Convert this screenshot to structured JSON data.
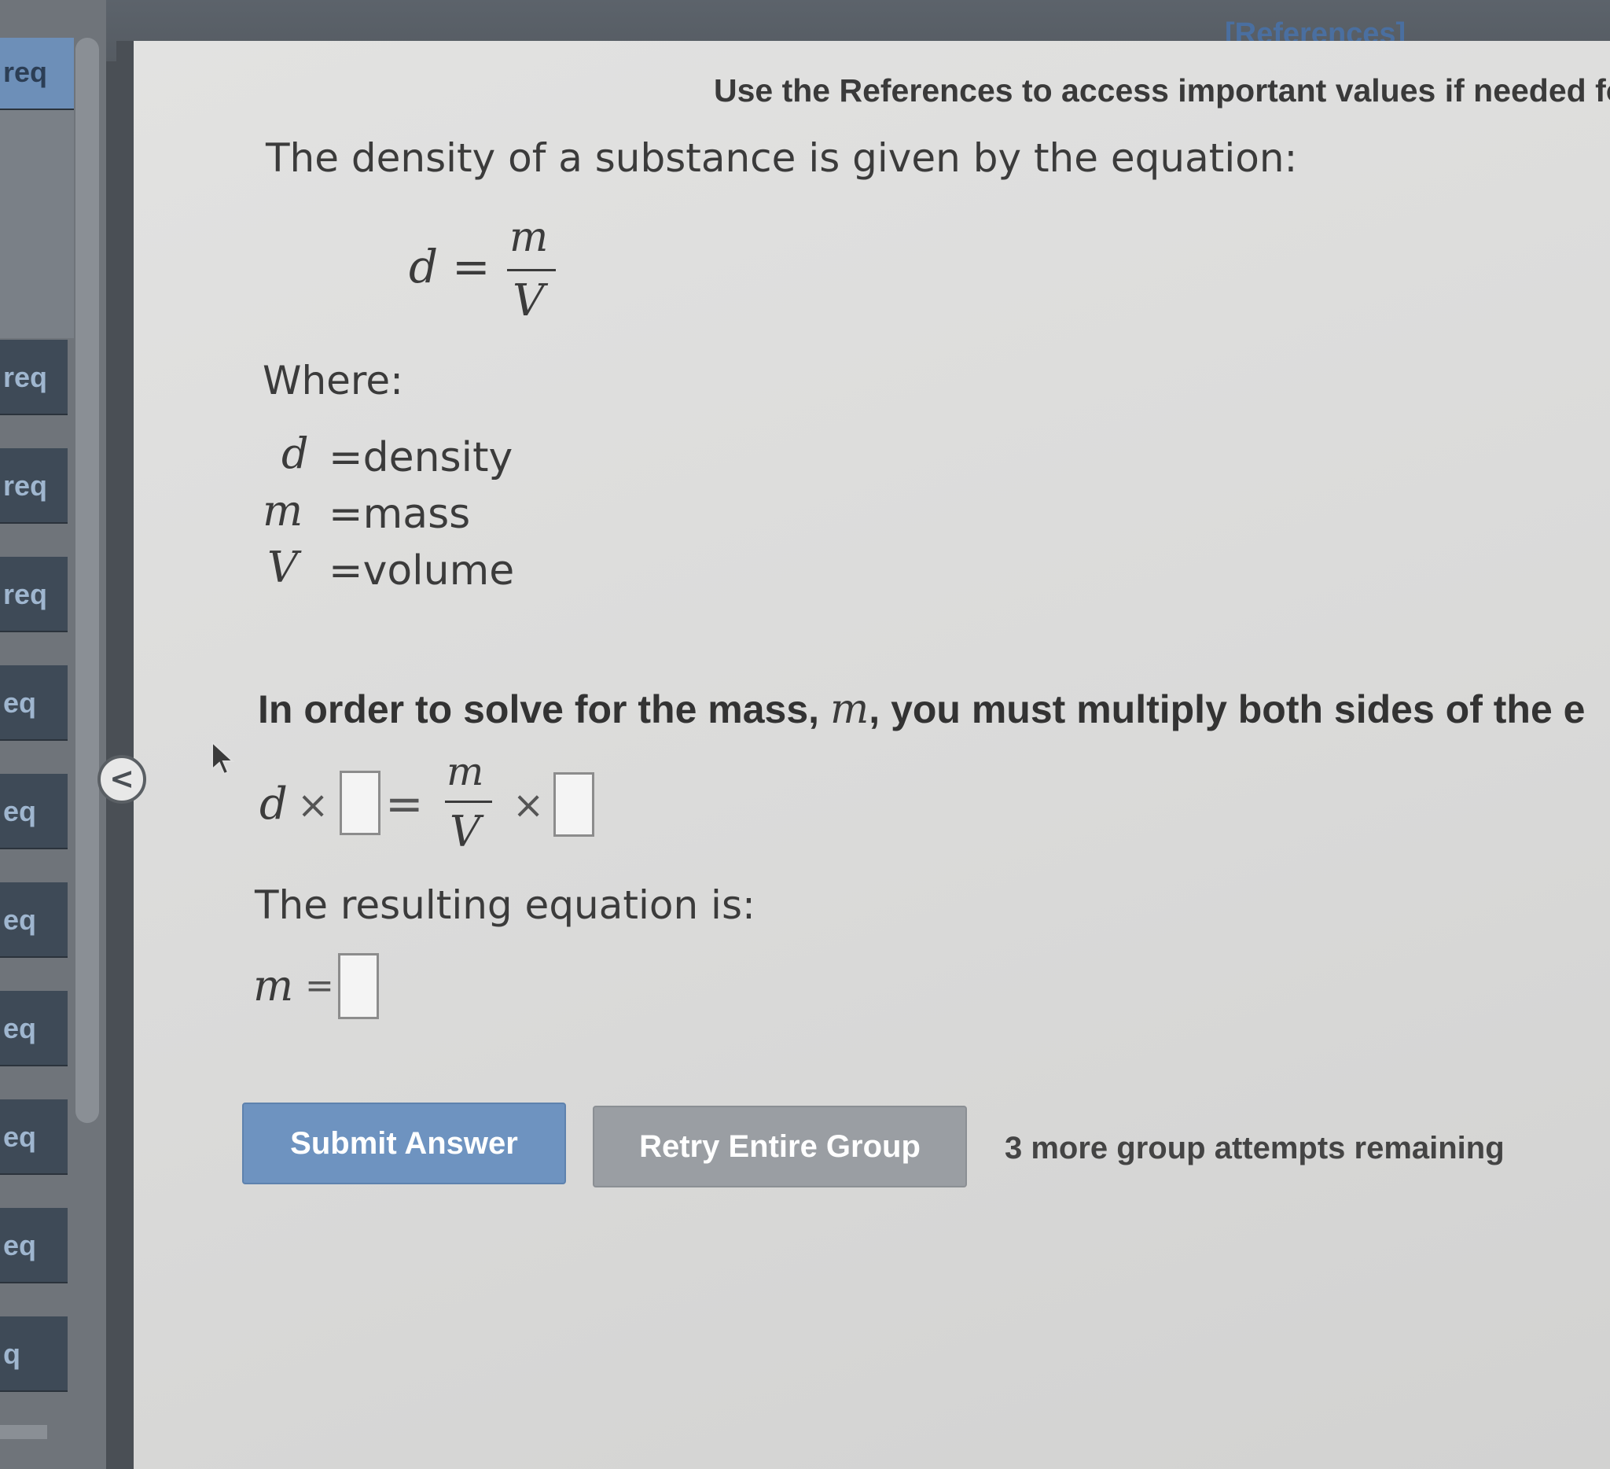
{
  "header": {
    "references_link": "[References]",
    "reference_note": "Use the References to access important values if needed fo"
  },
  "sidebar": {
    "items": [
      {
        "label": "req"
      },
      {
        "label": "req"
      },
      {
        "label": "req"
      },
      {
        "label": "req"
      },
      {
        "label": "eq"
      },
      {
        "label": "eq"
      },
      {
        "label": "eq"
      },
      {
        "label": "eq"
      },
      {
        "label": "eq"
      },
      {
        "label": "eq"
      },
      {
        "label": "q"
      }
    ],
    "collapse_glyph": "<"
  },
  "question": {
    "intro": "The density of a substance is given by the equation:",
    "equation": {
      "lhs": "d",
      "equals": "=",
      "numerator": "m",
      "denominator": "V"
    },
    "where_label": "Where:",
    "definitions": [
      {
        "symbol": "d",
        "meaning": "=density"
      },
      {
        "symbol": "m",
        "meaning": "=mass"
      },
      {
        "symbol": "V",
        "meaning": "=volume"
      }
    ],
    "instruction_prefix": "In order to solve for the mass, ",
    "instruction_symbol": "m",
    "instruction_suffix": ", you must multiply both sides of the e",
    "step": {
      "lhs": "d",
      "times1": "×",
      "equals": "=",
      "numerator": "m",
      "denominator": "V",
      "times2": "×"
    },
    "resulting_label": "The resulting equation is:",
    "result": {
      "lhs": "m",
      "equals": "="
    }
  },
  "actions": {
    "submit_label": "Submit Answer",
    "retry_label": "Retry Entire Group",
    "attempts_text": "3 more group attempts remaining"
  },
  "colors": {
    "submit_button": "#6e93c0",
    "retry_button": "#9a9ea3",
    "references_link": "#4a6fa0"
  }
}
